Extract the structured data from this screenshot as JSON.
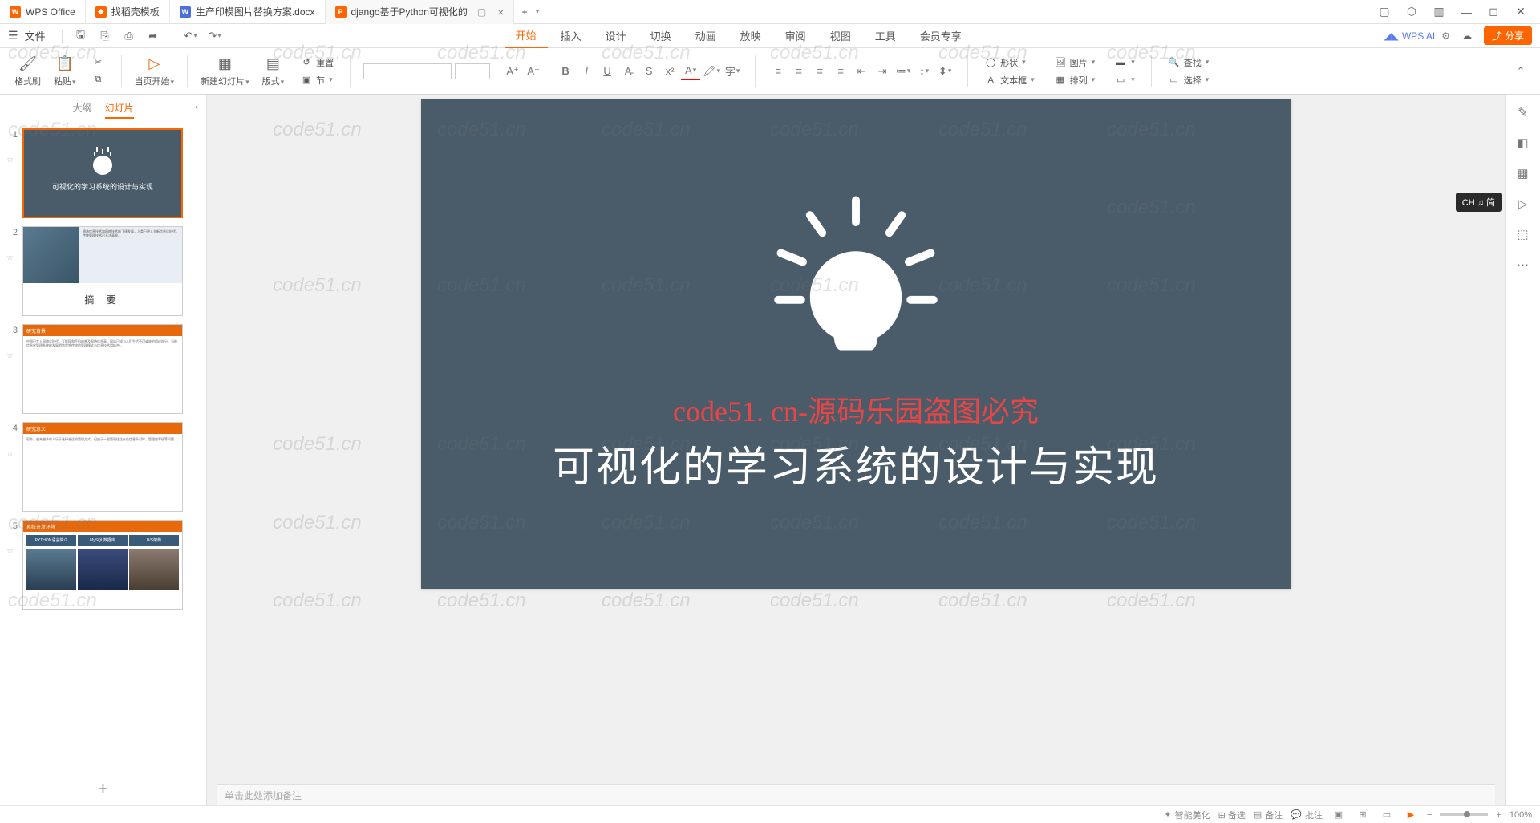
{
  "titlebar": {
    "app_name": "WPS Office",
    "tabs": [
      {
        "label": "找稻壳模板",
        "icon_color": "#fd6500"
      },
      {
        "label": "生产印模图片替换方案.docx",
        "icon_letter": "W",
        "icon_color": "#4a6fd8"
      },
      {
        "label": "django基于Python可视化的",
        "icon_letter": "P",
        "icon_color": "#fd6500",
        "active": true
      }
    ],
    "add_tab": "+"
  },
  "menubar": {
    "file": "文件",
    "tabs": [
      "开始",
      "插入",
      "设计",
      "切换",
      "动画",
      "放映",
      "审阅",
      "视图",
      "工具",
      "会员专享"
    ],
    "active_tab": "开始",
    "wps_ai": "WPS AI",
    "share": "分享"
  },
  "ribbon": {
    "format_painter": "格式刷",
    "paste": "粘贴",
    "from_current": "当页开始",
    "new_slide": "新建幻灯片",
    "layout": "版式",
    "section": "节",
    "reset": "重置",
    "shape": "形状",
    "picture": "图片",
    "textbox": "文本框",
    "arrange": "排列",
    "find": "查找",
    "select": "选择"
  },
  "panel": {
    "outline": "大纲",
    "slides": "幻灯片"
  },
  "slides": {
    "s1_text": "可视化的学习系统的设计与实现",
    "s2_title": "摘   要",
    "s3_header": "研究背景",
    "s4_header": "研究意义",
    "s5_header": "系统开发环境",
    "s5_box1": "PYTHON语言简介",
    "s5_box2": "MySQL数据库",
    "s5_box3": "B/S架构"
  },
  "canvas": {
    "watermark": "code51. cn-源码乐园盗图必究",
    "title": "可视化的学习系统的设计与实现"
  },
  "notes": {
    "placeholder": "单击此处添加备注"
  },
  "ime": {
    "label": "CH ♫ 简"
  },
  "statusbar": {
    "beautify": "智能美化",
    "notes": "备注",
    "comments": "批注",
    "zoom": "100%"
  },
  "watermark_text": "code51.cn"
}
